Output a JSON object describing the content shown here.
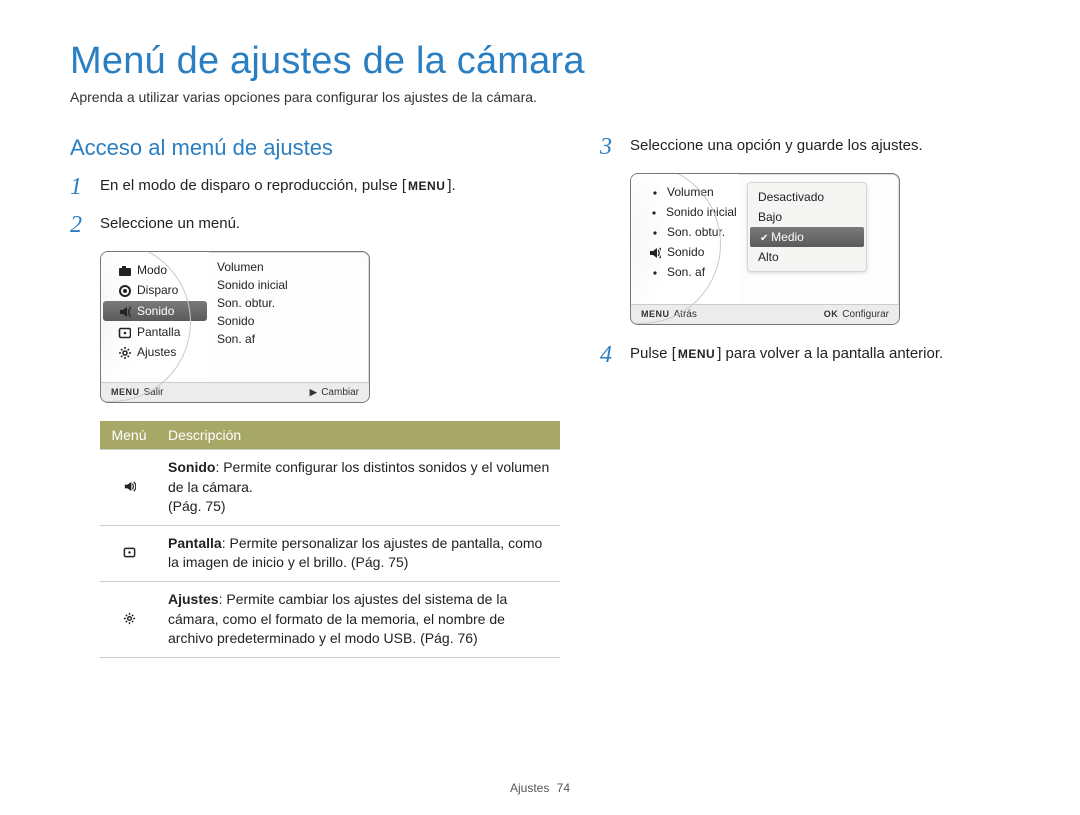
{
  "header": {
    "title": "Menú de ajustes de la cámara",
    "subtitle": "Aprenda a utilizar varias opciones para configurar los ajustes de la cámara."
  },
  "section_title": "Acceso al menú de ajustes",
  "steps": {
    "s1_pre": "En el modo de disparo o reproducción, pulse [",
    "s1_btn": "MENU",
    "s1_post": "].",
    "s2": "Seleccione un menú.",
    "s3": "Seleccione una opción y guarde los ajustes.",
    "s4_pre": "Pulse [",
    "s4_btn": "MENU",
    "s4_post": "] para volver a la pantalla anterior."
  },
  "lcd1": {
    "left": [
      "Modo",
      "Disparo",
      "Sonido",
      "Pantalla",
      "Ajustes"
    ],
    "selected_left": "Sonido",
    "right": [
      "Volumen",
      "Sonido inicial",
      "Son. obtur.",
      "Sonido",
      "Son. af"
    ],
    "footer_left_icon": "MENU",
    "footer_left": "Salir",
    "footer_right_icon": "▶",
    "footer_right": "Cambiar"
  },
  "lcd2": {
    "left": [
      "Volumen",
      "Sonido inicial",
      "Son. obtur.",
      "Sonido",
      "Son. af"
    ],
    "center_icon_row": "Sonido",
    "right": [
      "Desactivado",
      "Bajo",
      "Medio",
      "Alto"
    ],
    "selected_right": "Medio",
    "footer_left_icon": "MENU",
    "footer_left": "Atrás",
    "footer_right_icon": "OK",
    "footer_right": "Configurar"
  },
  "table": {
    "h1": "Menú",
    "h2": "Descripción",
    "rows": [
      {
        "icon": "sound",
        "bold": "Sonido",
        "text": ": Permite configurar los distintos sonidos y el volumen de la cámara.",
        "page": "(Pág. 75)"
      },
      {
        "icon": "screen",
        "bold": "Pantalla",
        "text": ": Permite personalizar los ajustes de pantalla, como la imagen de inicio y el brillo. (Pág. 75)",
        "page": ""
      },
      {
        "icon": "gear",
        "bold": "Ajustes",
        "text": ": Permite cambiar los ajustes del sistema de la cámara, como el formato de la memoria, el nombre de archivo predeterminado y el modo USB. (Pág. 76)",
        "page": ""
      }
    ]
  },
  "footer": {
    "label": "Ajustes",
    "page": "74"
  }
}
